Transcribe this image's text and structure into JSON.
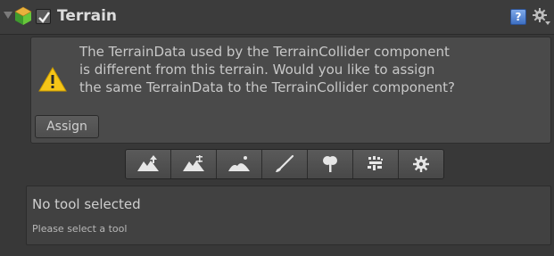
{
  "header": {
    "title": "Terrain",
    "enabled": true,
    "foldout_icon": "foldout-arrow-icon",
    "component_icon": "terrain-icon",
    "help_icon": "help-icon",
    "help_glyph": "?",
    "settings_icon": "gear-icon"
  },
  "warning": {
    "icon": "warning-icon",
    "message": "The TerrainData used by the TerrainCollider component\nis different from this terrain. Would you like to assign\nthe same TerrainData to the TerrainCollider component?",
    "assign_label": "Assign"
  },
  "toolbar": {
    "tools": [
      {
        "icon": "raise-lower-terrain-icon"
      },
      {
        "icon": "paint-height-icon"
      },
      {
        "icon": "smooth-height-icon"
      },
      {
        "icon": "paint-texture-icon"
      },
      {
        "icon": "place-trees-icon"
      },
      {
        "icon": "paint-details-icon"
      },
      {
        "icon": "terrain-settings-icon"
      }
    ]
  },
  "info": {
    "title": "No tool selected",
    "subtitle": "Please select a tool"
  },
  "colors": {
    "background": "#383838",
    "text": "#c8c8c8",
    "warning": "#f5c518"
  }
}
